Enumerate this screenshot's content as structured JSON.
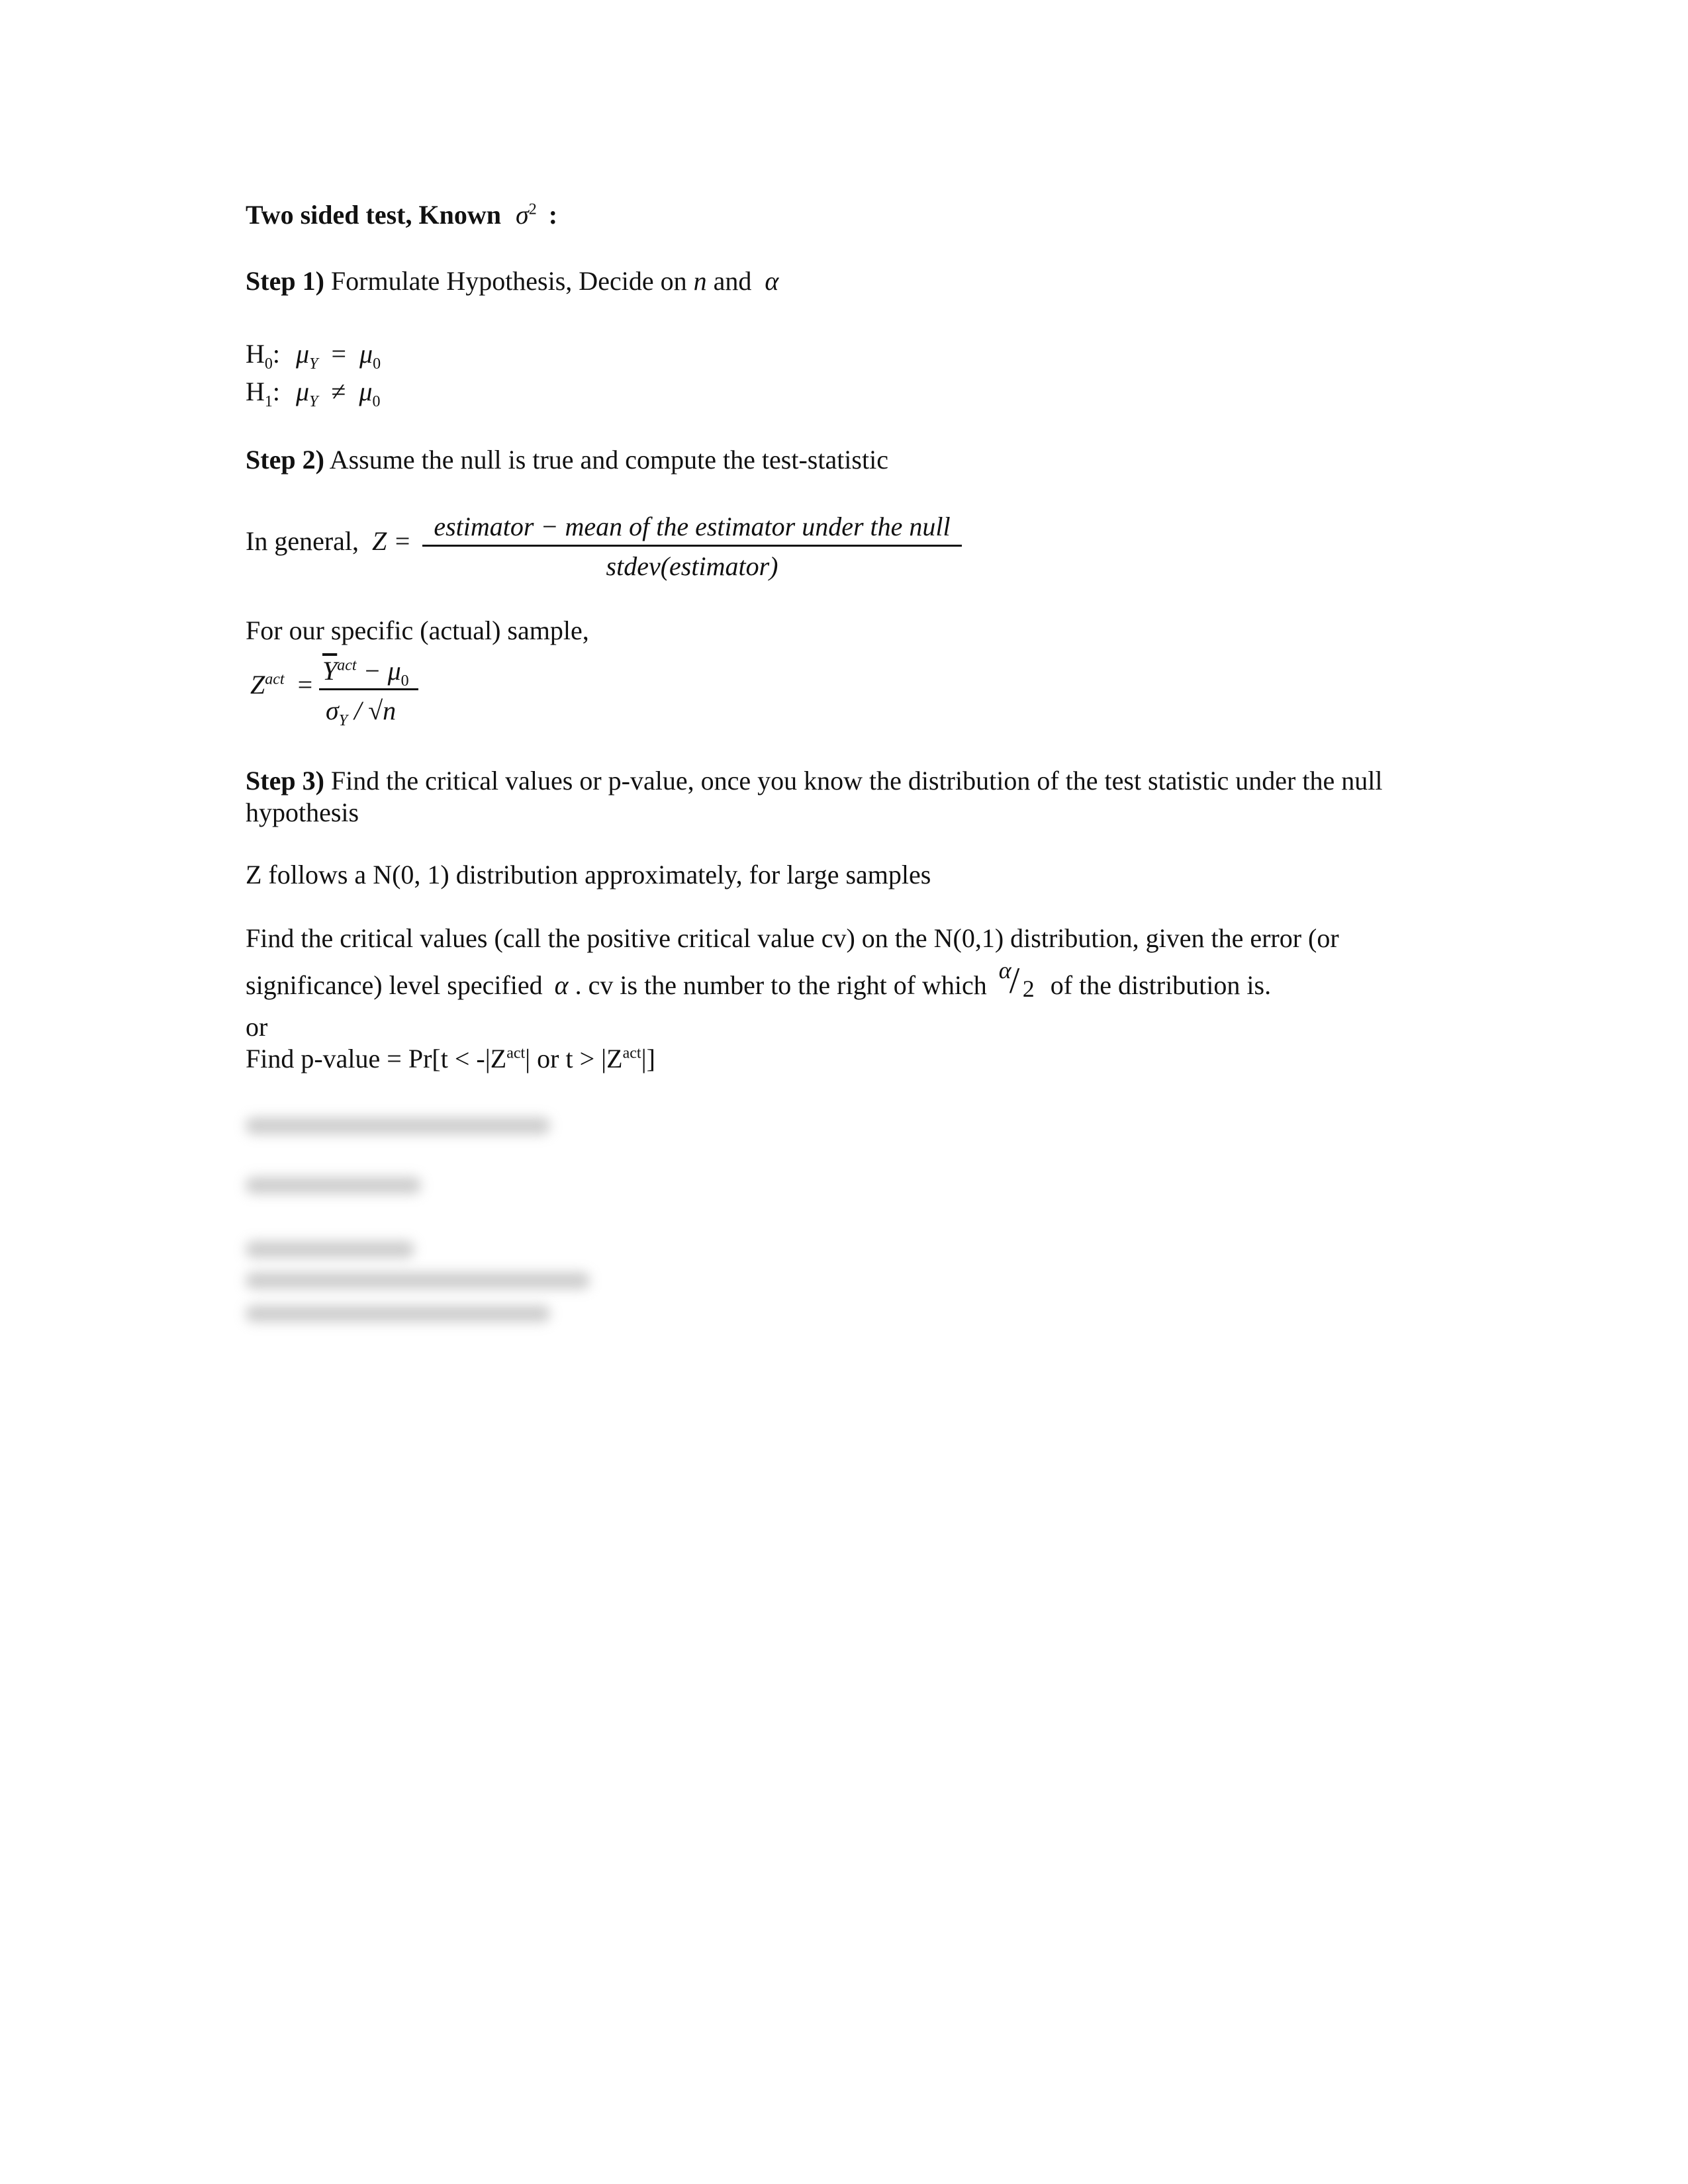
{
  "title": {
    "text": "Two sided test, Known",
    "symbol": "σ",
    "sup": "2",
    "suffix": ":"
  },
  "step1": {
    "label": "Step 1)",
    "text": "Formulate Hypothesis, Decide on",
    "n": "n",
    "and": "and",
    "alpha": "α"
  },
  "hypotheses": [
    {
      "h": "H",
      "sub": "0",
      "colon": ":",
      "lhs": "μ",
      "lhs_sub": "Y",
      "op": "=",
      "rhs": "μ",
      "rhs_sub": "0"
    },
    {
      "h": "H",
      "sub": "1",
      "colon": ":",
      "lhs": "μ",
      "lhs_sub": "Y",
      "op": "≠",
      "rhs": "μ",
      "rhs_sub": "0"
    }
  ],
  "step2": {
    "label": "Step 2)",
    "text": "Assume the null is true and compute the test-statistic"
  },
  "general": {
    "prefix": "In general,",
    "lhs": "Z =",
    "numerator": "estimator − mean of  the estimator under the null",
    "denominator": "stdev(estimator)"
  },
  "specific": {
    "text": "For our specific (actual) sample,",
    "lhs": "Z",
    "lhs_sup": "act",
    "eq": "=",
    "num_var": "Y",
    "num_sup": "act",
    "num_minus": "− μ",
    "num_sub": "0",
    "den_sigma": "σ",
    "den_sub": "Y",
    "den_rest": "/ √n"
  },
  "step3": {
    "label": "Step 3)",
    "text": "Find the critical values or p-value, once you know the distribution of the test statistic under the null",
    "text_cont": "hypothesis"
  },
  "z_follows": "Z follows a N(0, 1) distribution approximately, for large samples",
  "critical": {
    "line1": "Find the critical values (call the positive critical value cv) on the N(0,1) distribution, given the error (or",
    "line2_a": "significance) level specified",
    "alpha": "α",
    "line2_b": ". cv is the number to the right of which",
    "frac_num": "α",
    "frac_den": "2",
    "line2_c": "of the distribution is."
  },
  "or": "or",
  "pvalue": {
    "prefix": "Find p-value = Pr[t < -|Z",
    "sup1": "act",
    "mid": "| or t > |Z",
    "sup2": "act",
    "suffix": "|]"
  },
  "step4_blurred": true
}
